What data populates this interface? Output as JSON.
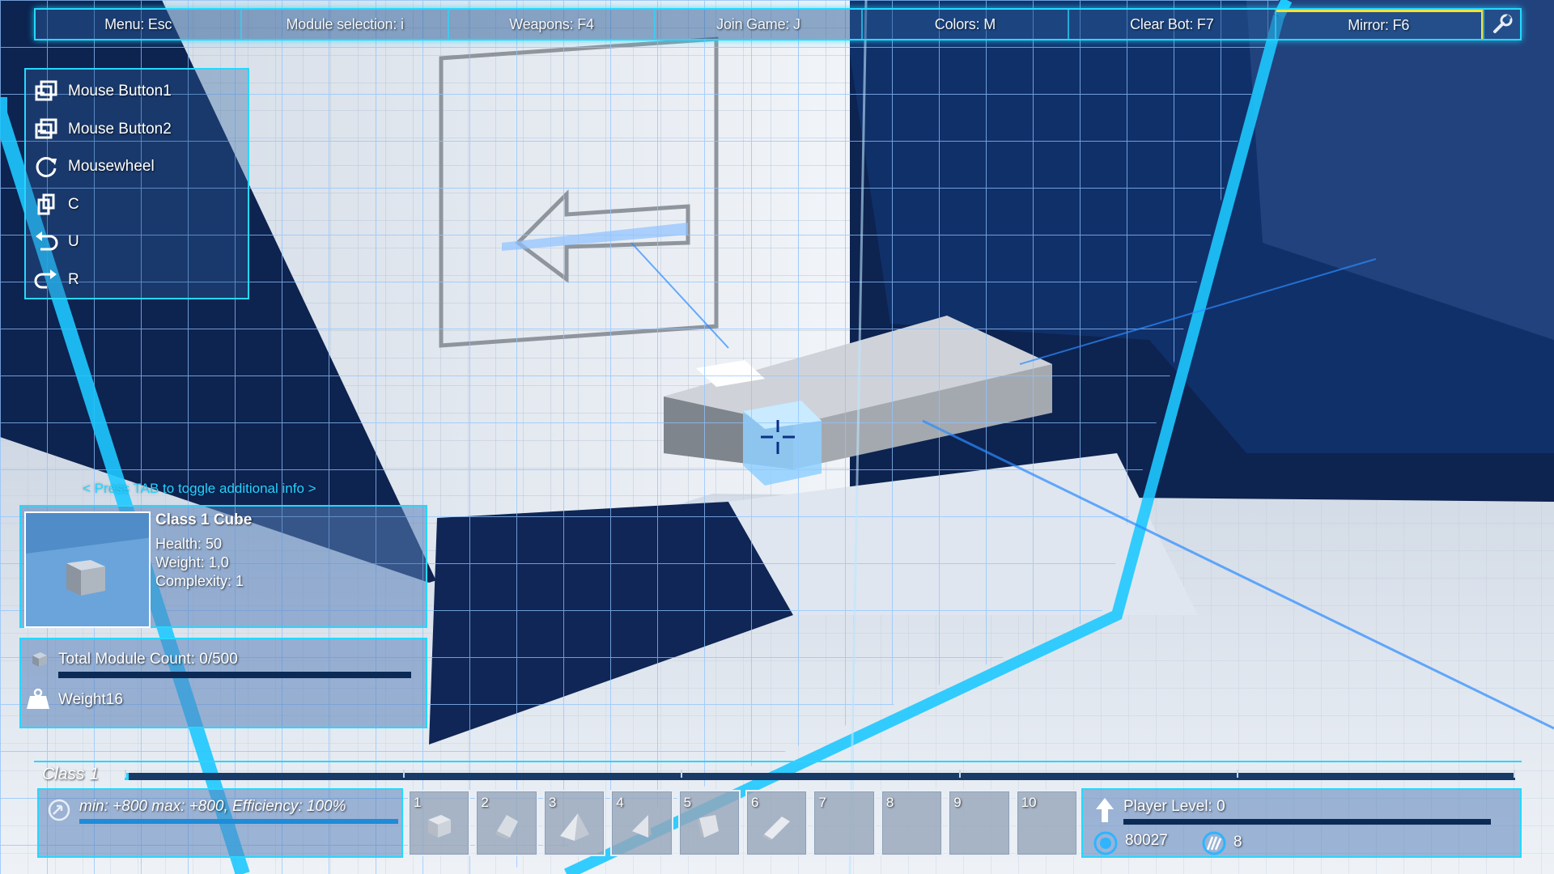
{
  "topbar": {
    "items": [
      {
        "label": "Menu: Esc"
      },
      {
        "label": "Module selection: i"
      },
      {
        "label": "Weapons: F4"
      },
      {
        "label": "Join Game: J"
      },
      {
        "label": "Colors: M"
      },
      {
        "label": "Clear Bot: F7"
      },
      {
        "label": "Mirror: F6",
        "active": true
      }
    ],
    "wrench_icon": "wrench-icon"
  },
  "controls": [
    {
      "icon": "mouse-button1-icon",
      "label": "Mouse Button1"
    },
    {
      "icon": "mouse-button2-icon",
      "label": "Mouse Button2"
    },
    {
      "icon": "rotate-icon",
      "label": "Mousewheel"
    },
    {
      "icon": "copy-icon",
      "label": "C"
    },
    {
      "icon": "undo-icon",
      "label": "U"
    },
    {
      "icon": "redo-icon",
      "label": "R"
    }
  ],
  "tab_hint": "< Press TAB to toggle additional info >",
  "module": {
    "name": "Class 1 Cube",
    "health": "Health: 50",
    "weight": "Weight: 1,0",
    "complexity": "Complexity: 1"
  },
  "counts": {
    "total_label": "Total Module Count: 0/500",
    "total_fraction": 0,
    "weight_label": "Weight16"
  },
  "class_bar": {
    "label": "Class 1",
    "progress_fraction": 0.002
  },
  "power": {
    "text": "min: +800 max: +800, Efficiency: 100%",
    "efficiency_fraction": 1.0
  },
  "hotbar": [
    {
      "num": "1",
      "shape": "cube"
    },
    {
      "num": "2",
      "shape": "slope"
    },
    {
      "num": "3",
      "shape": "pyramid"
    },
    {
      "num": "4",
      "shape": "wedge"
    },
    {
      "num": "5",
      "shape": "corner"
    },
    {
      "num": "6",
      "shape": "ramp"
    },
    {
      "num": "7",
      "shape": "empty"
    },
    {
      "num": "8",
      "shape": "empty"
    },
    {
      "num": "9",
      "shape": "empty"
    },
    {
      "num": "10",
      "shape": "empty"
    }
  ],
  "player": {
    "level": "Player Level: 0",
    "currency": "80027",
    "tech_points": "8"
  },
  "colors": {
    "accent": "#25d8ff",
    "active_outline": "#ffe233"
  }
}
